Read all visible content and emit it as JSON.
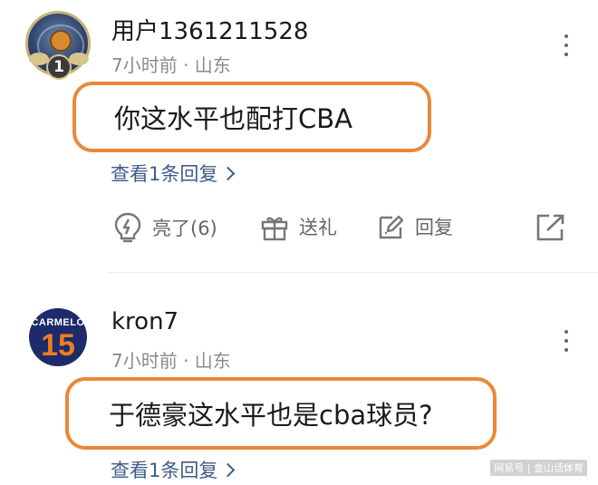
{
  "comments": [
    {
      "username": "用户1361211528",
      "meta": "7小时前 · 山东",
      "text": "你这水平也配打CBA",
      "replies_link": "查看1条回复",
      "level_badge": "1",
      "actions": {
        "like": "亮了(6)",
        "gift": "送礼",
        "reply": "回复"
      }
    },
    {
      "username": "kron7",
      "meta": "7小时前 · 山东",
      "text": "于德豪这水平也是cba球员?",
      "replies_link": "查看1条回复",
      "avatar_jersey_name": "CARMELO",
      "avatar_jersey_number": "15"
    }
  ],
  "watermark": "网易号 | 金山话体育",
  "colors": {
    "highlight_border": "#e8893a",
    "link": "#3f5c8a",
    "meta_gray": "#8b8b8b"
  },
  "icons": [
    "lightbulb-icon",
    "gift-icon",
    "edit-reply-icon",
    "share-icon",
    "more-vertical-icon",
    "chevron-right-icon"
  ]
}
